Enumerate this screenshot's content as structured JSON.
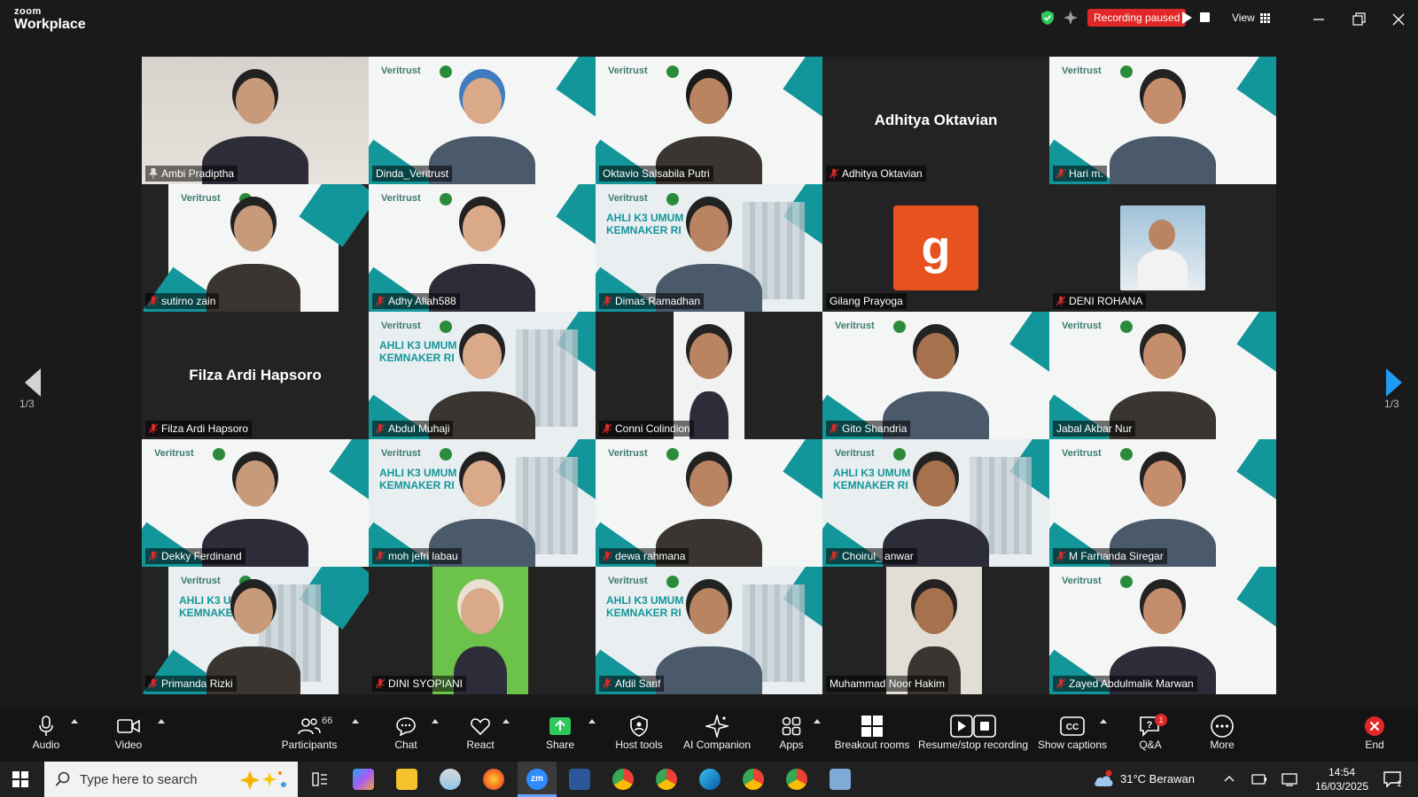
{
  "app": {
    "brand_top": "zoom",
    "brand_bottom": "Workplace"
  },
  "topbar": {
    "recording_status": "Recording paused",
    "view_label": "View"
  },
  "colors": {
    "recording": "#e02828",
    "active_speaker": "#2fc85a",
    "accent": "#13969a"
  },
  "gallery": {
    "page_indicator_left": "1/3",
    "page_indicator_right": "1/3",
    "tiles": [
      {
        "name": "Ambi Pradiptha",
        "type": "video",
        "pinned": true
      },
      {
        "name": "Dinda_Veritrust",
        "type": "video"
      },
      {
        "name": "Oktavio Salsabila Putri",
        "type": "video",
        "active": true
      },
      {
        "name": "Adhitya Oktavian",
        "type": "name",
        "display": "Adhitya Oktavian",
        "muted": true
      },
      {
        "name": "Hari m.",
        "type": "video",
        "muted": true
      },
      {
        "name": "sutirno zain",
        "type": "video",
        "muted": true
      },
      {
        "name": "Adhy Allah588",
        "type": "video",
        "muted": true
      },
      {
        "name": "Dimas Ramadhan",
        "type": "video",
        "muted": true
      },
      {
        "name": "Gilang Prayoga",
        "type": "avatar",
        "initial": "g"
      },
      {
        "name": "DENI ROHANA",
        "type": "photo",
        "muted": true
      },
      {
        "name": "Filza Ardi Hapsoro",
        "type": "name",
        "display": "Filza Ardi Hapsoro",
        "muted": true
      },
      {
        "name": "Abdul Muhaji",
        "type": "video",
        "muted": true
      },
      {
        "name": "Conni Colindion",
        "type": "video",
        "muted": true
      },
      {
        "name": "Gito Shandria",
        "type": "video",
        "muted": true
      },
      {
        "name": "Jabal Akbar Nur",
        "type": "video"
      },
      {
        "name": "Dekky Ferdinand",
        "type": "video",
        "muted": true
      },
      {
        "name": "moh jefri labau",
        "type": "video",
        "muted": true
      },
      {
        "name": "dewa rahmana",
        "type": "video",
        "muted": true
      },
      {
        "name": "Choirul_ anwar",
        "type": "video",
        "muted": true
      },
      {
        "name": "M Farhanda Siregar",
        "type": "video",
        "muted": true
      },
      {
        "name": "Primanda Rizki",
        "type": "video",
        "muted": true
      },
      {
        "name": "DINI SYOPIANI",
        "type": "video",
        "muted": true
      },
      {
        "name": "Afdil Sarif",
        "type": "video",
        "muted": true
      },
      {
        "name": "Muhammad Noor Hakim",
        "type": "video"
      },
      {
        "name": "Zayed Abdulmalik Marwan",
        "type": "video",
        "muted": true
      }
    ],
    "backdrop": {
      "brand": "Veritrust",
      "k3_line1": "AHLI K3 UMUM",
      "k3_line2": "KEMNAKER RI"
    }
  },
  "toolbar": {
    "audio": "Audio",
    "video": "Video",
    "participants": "Participants",
    "participants_count": "66",
    "chat": "Chat",
    "react": "React",
    "share": "Share",
    "host_tools": "Host tools",
    "ai_companion": "AI Companion",
    "apps": "Apps",
    "breakout_rooms": "Breakout rooms",
    "resume_stop_recording": "Resume/stop recording",
    "show_captions": "Show captions",
    "qa": "Q&A",
    "qa_badge": "1",
    "more": "More",
    "end": "End"
  },
  "taskbar": {
    "search_placeholder": "Type here to search",
    "weather": "31°C  Berawan",
    "time": "14:54",
    "date": "16/03/2025",
    "notification_count": "1"
  }
}
